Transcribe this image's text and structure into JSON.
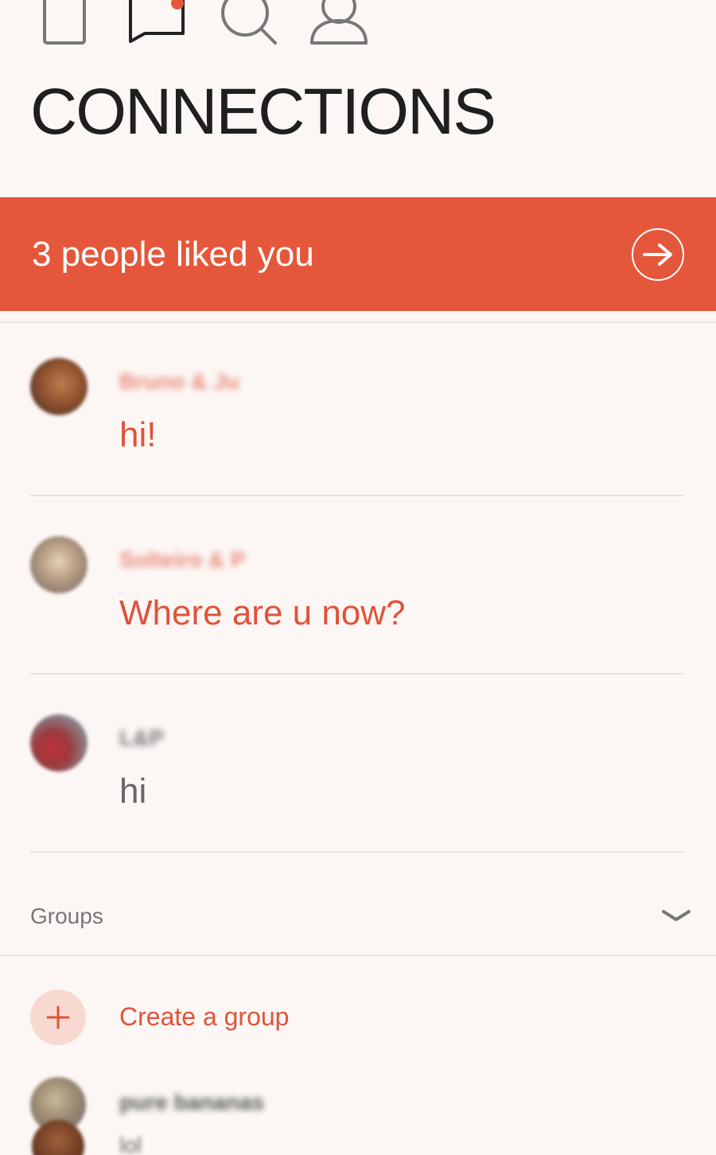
{
  "header": {
    "title": "CONNECTIONS",
    "nav": [
      {
        "icon": "cards-icon"
      },
      {
        "icon": "chat-icon",
        "has_notification": true
      },
      {
        "icon": "search-icon"
      },
      {
        "icon": "profile-icon"
      }
    ]
  },
  "likes_banner": {
    "text": "3 people liked you",
    "icon": "arrow-right-icon",
    "color": "#e5573b"
  },
  "conversations": [
    {
      "name": "Bruno & Ju",
      "message": "hi!",
      "unread": true
    },
    {
      "name": "Solteiro & P",
      "message": "Where are u now?",
      "unread": true
    },
    {
      "name": "L&P",
      "message": "hi",
      "unread": false
    }
  ],
  "groups": {
    "label": "Groups",
    "create_label": "Create a group",
    "items": [
      {
        "name": "pure bananas",
        "message": "lol"
      }
    ]
  },
  "colors": {
    "accent": "#e0533a",
    "background": "#fcf7f5"
  }
}
